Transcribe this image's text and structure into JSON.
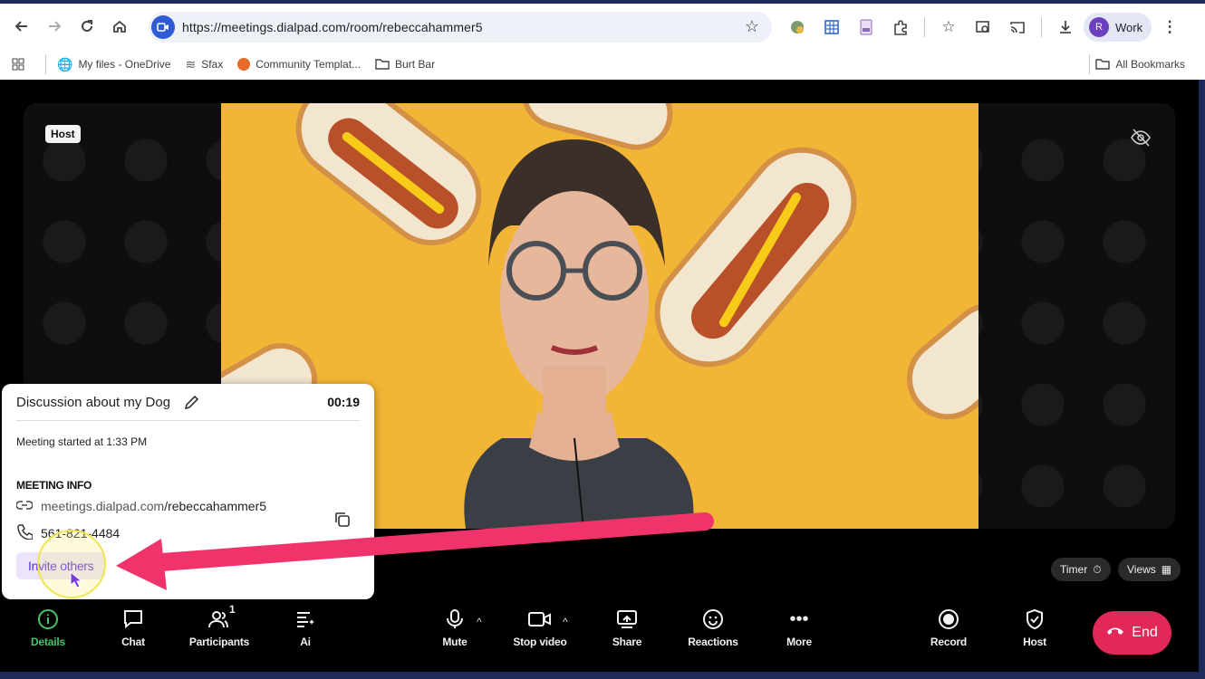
{
  "browser": {
    "url": "https://meetings.dialpad.com/room/rebeccahammer5",
    "profile_initial": "R",
    "profile_label": "Work",
    "bookmarks": [
      {
        "label": "My files - OneDrive"
      },
      {
        "label": "Sfax"
      },
      {
        "label": "Community Templat..."
      },
      {
        "label": "Burt Bar"
      }
    ],
    "all_bookmarks": "All Bookmarks"
  },
  "meeting": {
    "host_tag": "Host",
    "timer_pill": "Timer",
    "views_pill": "Views",
    "participant_count": "1",
    "controls": {
      "details": "Details",
      "chat": "Chat",
      "participants": "Participants",
      "ai": "Ai",
      "mute": "Mute",
      "stop_video": "Stop video",
      "share": "Share",
      "reactions": "Reactions",
      "more": "More",
      "record": "Record",
      "host": "Host",
      "end": "End"
    }
  },
  "details_panel": {
    "title": "Discussion about my Dog",
    "elapsed": "00:19",
    "started": "Meeting started at 1:33 PM",
    "info_heading": "MEETING INFO",
    "link_domain": "meetings.dialpad.com",
    "link_path": "/rebeccahammer5",
    "phone": "561-821-4484",
    "invite_label": "Invite others"
  },
  "colors": {
    "accent_purple": "#5a2ee0",
    "end_red": "#e22856",
    "details_active_green": "#49c46a",
    "annotation_arrow": "#f0336a"
  }
}
